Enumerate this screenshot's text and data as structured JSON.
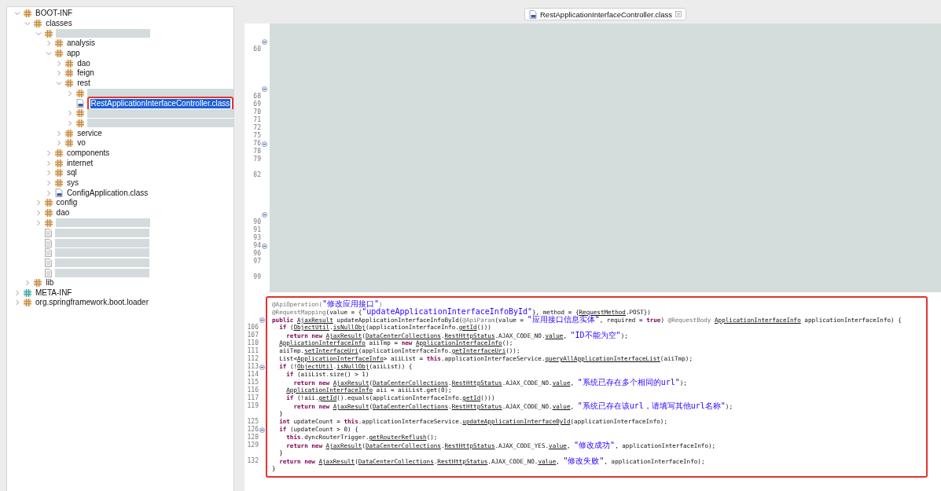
{
  "explorer": {
    "tree": [
      {
        "label": "BOOT-INF",
        "kind": "package",
        "expanded": true,
        "selected": false,
        "children": [
          {
            "label": "classes",
            "kind": "package",
            "expanded": true,
            "selected": false,
            "children": [
              {
                "redacted": true,
                "kind": "package",
                "expanded": true,
                "selected": false,
                "children": [
                  {
                    "label": "analysis",
                    "kind": "package",
                    "expanded": false,
                    "selected": false
                  },
                  {
                    "label": "app",
                    "kind": "package",
                    "expanded": true,
                    "selected": false,
                    "children": [
                      {
                        "label": "dao",
                        "kind": "package",
                        "expanded": false,
                        "selected": false
                      },
                      {
                        "label": "feign",
                        "kind": "package",
                        "expanded": false,
                        "selected": false
                      },
                      {
                        "label": "rest",
                        "kind": "package",
                        "expanded": true,
                        "selected": false,
                        "children": [
                          {
                            "redacted": true,
                            "kind": "package",
                            "expanded": false,
                            "selected": false
                          },
                          {
                            "label": "RestApplicationInterfaceController.class",
                            "kind": "class",
                            "selected": true,
                            "highlighted": true
                          },
                          {
                            "redacted": true,
                            "kind": "package",
                            "expanded": false,
                            "selected": false
                          },
                          {
                            "redacted": true,
                            "kind": "package",
                            "expanded": false,
                            "selected": false
                          }
                        ]
                      },
                      {
                        "label": "service",
                        "kind": "package",
                        "expanded": false,
                        "selected": false
                      },
                      {
                        "label": "vo",
                        "kind": "package",
                        "expanded": false,
                        "selected": false
                      }
                    ]
                  },
                  {
                    "label": "components",
                    "kind": "package",
                    "expanded": false,
                    "selected": false
                  },
                  {
                    "label": "internet",
                    "kind": "package",
                    "expanded": false,
                    "selected": false
                  },
                  {
                    "label": "sql",
                    "kind": "package",
                    "expanded": false,
                    "selected": false
                  },
                  {
                    "label": "sys",
                    "kind": "package",
                    "expanded": false,
                    "selected": false
                  },
                  {
                    "label": "ConfigApplication.class",
                    "kind": "class",
                    "expanded": false,
                    "selected": false
                  }
                ]
              },
              {
                "label": "config",
                "kind": "package",
                "expanded": false,
                "selected": false
              },
              {
                "label": "dao",
                "kind": "package",
                "expanded": false,
                "selected": false
              },
              {
                "redacted": true,
                "kind": "package",
                "expanded": false,
                "selected": false
              },
              {
                "redacted": true,
                "kind": "file",
                "selected": false
              },
              {
                "redacted": true,
                "kind": "file",
                "selected": false
              },
              {
                "redacted": true,
                "kind": "file",
                "selected": false
              },
              {
                "redacted": true,
                "kind": "file",
                "selected": false
              },
              {
                "redacted": true,
                "kind": "file",
                "selected": false
              }
            ]
          },
          {
            "label": "lib",
            "kind": "package",
            "expanded": false,
            "selected": false
          }
        ]
      },
      {
        "label": "META-INF",
        "kind": "folder",
        "expanded": false,
        "selected": false
      },
      {
        "label": "org.springframework.boot.loader",
        "kind": "package",
        "expanded": false,
        "selected": false
      }
    ]
  },
  "tab": {
    "label": "RestApplicationInterfaceController.class",
    "selected": true
  },
  "gutter": [
    {
      "fold": true
    },
    {
      "number": "60",
      "fold": false
    },
    {
      "fold": false
    },
    {
      "fold": false
    },
    {
      "fold": false
    },
    {
      "fold": false
    },
    {
      "fold": true
    },
    {
      "number": "68",
      "fold": false
    },
    {
      "number": "69",
      "fold": false
    },
    {
      "number": "70",
      "fold": false
    },
    {
      "number": "71",
      "fold": false
    },
    {
      "number": "72",
      "fold": false
    },
    {
      "number": "75",
      "fold": false
    },
    {
      "number": "76",
      "fold": true
    },
    {
      "number": "78",
      "fold": false
    },
    {
      "number": "79",
      "fold": false
    },
    {
      "fold": false
    },
    {
      "number": "82",
      "fold": false
    },
    {
      "fold": false
    },
    {
      "fold": false
    },
    {
      "fold": false
    },
    {
      "fold": false
    },
    {
      "fold": true
    },
    {
      "number": "90",
      "fold": false
    },
    {
      "number": "91",
      "fold": false
    },
    {
      "number": "93",
      "fold": false
    },
    {
      "number": "94",
      "fold": true
    },
    {
      "number": "96",
      "fold": false
    },
    {
      "number": "97",
      "fold": false
    },
    {
      "fold": false
    },
    {
      "number": "99",
      "fold": false
    }
  ],
  "code": {
    "highlighted": true,
    "lines": [
      {
        "fold": false,
        "tokens": [
          {
            "kind": "annotation",
            "text": "@ApiOperation("
          },
          {
            "kind": "string",
            "text": "\"修改应用接口\""
          },
          {
            "kind": "annotation",
            "text": ")"
          }
        ]
      },
      {
        "fold": false,
        "tokens": [
          {
            "kind": "annotation",
            "text": "@RequestMapping"
          },
          {
            "kind": "plain",
            "text": "(value = {"
          },
          {
            "kind": "string",
            "text": "\"updateApplicationInterfaceInfoById\""
          },
          {
            "kind": "plain",
            "text": "}, method = {"
          },
          {
            "kind": "link",
            "text": "RequestMethod"
          },
          {
            "kind": "plain",
            "text": ".POST})"
          }
        ]
      },
      {
        "fold": true,
        "tokens": [
          {
            "kind": "keyword",
            "text": "public"
          },
          {
            "kind": "link",
            "text": " AjaxResult"
          },
          {
            "kind": "plain",
            "text": " updateApplicationInterfaceInfoById("
          },
          {
            "kind": "annotation",
            "text": "@ApiParam"
          },
          {
            "kind": "plain",
            "text": "(value = "
          },
          {
            "kind": "string",
            "text": "\"应用接口信息实体\""
          },
          {
            "kind": "plain",
            "text": ", required = "
          },
          {
            "kind": "keyword",
            "text": "true"
          },
          {
            "kind": "plain",
            "text": ") "
          },
          {
            "kind": "annotation",
            "text": "@RequestBody"
          },
          {
            "kind": "link",
            "text": " ApplicationInterfaceInfo"
          },
          {
            "kind": "plain",
            "text": " applicationInterfaceInfo) {"
          }
        ]
      },
      {
        "number": "106",
        "fold": false,
        "tokens": [
          {
            "kind": "keyword",
            "text": "  if"
          },
          {
            "kind": "plain",
            "text": " ("
          },
          {
            "kind": "link",
            "text": "ObjectUtil"
          },
          {
            "kind": "plain",
            "text": "."
          },
          {
            "kind": "link",
            "text": "isNullObj"
          },
          {
            "kind": "plain",
            "text": "(applicationInterfaceInfo."
          },
          {
            "kind": "link",
            "text": "getId"
          },
          {
            "kind": "plain",
            "text": "()))"
          }
        ]
      },
      {
        "number": "107",
        "fold": false,
        "tokens": [
          {
            "kind": "keyword",
            "text": "    return new"
          },
          {
            "kind": "link",
            "text": " AjaxResult"
          },
          {
            "kind": "plain",
            "text": "("
          },
          {
            "kind": "link",
            "text": "DataCenterCollections"
          },
          {
            "kind": "plain",
            "text": "."
          },
          {
            "kind": "link",
            "text": "RestHttpStatus"
          },
          {
            "kind": "plain",
            "text": ".AJAX_CODE_NO."
          },
          {
            "kind": "link",
            "text": "value"
          },
          {
            "kind": "plain",
            "text": ", "
          },
          {
            "kind": "string",
            "text": "\"ID不能为空\""
          },
          {
            "kind": "plain",
            "text": ");"
          }
        ]
      },
      {
        "number": "110",
        "fold": false,
        "tokens": [
          {
            "kind": "link",
            "text": "  ApplicationInterfaceInfo"
          },
          {
            "kind": "plain",
            "text": " aiiTmp = "
          },
          {
            "kind": "keyword",
            "text": "new"
          },
          {
            "kind": "link",
            "text": " ApplicationInterfaceInfo"
          },
          {
            "kind": "plain",
            "text": "();"
          }
        ]
      },
      {
        "number": "111",
        "fold": false,
        "tokens": [
          {
            "kind": "plain",
            "text": "  aiiTmp."
          },
          {
            "kind": "link",
            "text": "setInterfaceUri"
          },
          {
            "kind": "plain",
            "text": "(applicationInterfaceInfo."
          },
          {
            "kind": "link",
            "text": "getInterfaceUri"
          },
          {
            "kind": "plain",
            "text": "());"
          }
        ]
      },
      {
        "number": "112",
        "fold": false,
        "tokens": [
          {
            "kind": "plain",
            "text": "  List<"
          },
          {
            "kind": "link",
            "text": "ApplicationInterfaceInfo"
          },
          {
            "kind": "plain",
            "text": "> aiiList = "
          },
          {
            "kind": "keyword",
            "text": "this"
          },
          {
            "kind": "plain",
            "text": ".applicationInterfaceService."
          },
          {
            "kind": "link",
            "text": "queryAllApplicationInterfaceList"
          },
          {
            "kind": "plain",
            "text": "(aiiTmp);"
          }
        ]
      },
      {
        "number": "113",
        "fold": true,
        "tokens": [
          {
            "kind": "keyword",
            "text": "  if"
          },
          {
            "kind": "plain",
            "text": " (!"
          },
          {
            "kind": "link",
            "text": "ObjectUtil"
          },
          {
            "kind": "plain",
            "text": "."
          },
          {
            "kind": "link",
            "text": "isNullObj"
          },
          {
            "kind": "plain",
            "text": "(aiiList)) {"
          }
        ]
      },
      {
        "number": "114",
        "fold": false,
        "tokens": [
          {
            "kind": "keyword",
            "text": "    if"
          },
          {
            "kind": "plain",
            "text": " (aiiList.size() > 1)"
          }
        ]
      },
      {
        "number": "115",
        "fold": false,
        "tokens": [
          {
            "kind": "keyword",
            "text": "      return new"
          },
          {
            "kind": "link",
            "text": " AjaxResult"
          },
          {
            "kind": "plain",
            "text": "("
          },
          {
            "kind": "link",
            "text": "DataCenterCollections"
          },
          {
            "kind": "plain",
            "text": "."
          },
          {
            "kind": "link",
            "text": "RestHttpStatus"
          },
          {
            "kind": "plain",
            "text": ".AJAX_CODE_NO."
          },
          {
            "kind": "link",
            "text": "value"
          },
          {
            "kind": "plain",
            "text": ", "
          },
          {
            "kind": "string",
            "text": "\"系统已存在多个相同的url\""
          },
          {
            "kind": "plain",
            "text": ");"
          }
        ]
      },
      {
        "number": "116",
        "fold": false,
        "tokens": [
          {
            "kind": "link",
            "text": "    ApplicationInterfaceInfo"
          },
          {
            "kind": "plain",
            "text": " aii = aiiList.get(0);"
          }
        ]
      },
      {
        "number": "117",
        "fold": false,
        "tokens": [
          {
            "kind": "keyword",
            "text": "    if"
          },
          {
            "kind": "plain",
            "text": " (!aii."
          },
          {
            "kind": "link",
            "text": "getId"
          },
          {
            "kind": "plain",
            "text": "().equals(applicationInterfaceInfo."
          },
          {
            "kind": "link",
            "text": "getId"
          },
          {
            "kind": "plain",
            "text": "()))"
          }
        ]
      },
      {
        "number": "119",
        "fold": false,
        "tokens": [
          {
            "kind": "keyword",
            "text": "      return new"
          },
          {
            "kind": "link",
            "text": " AjaxResult"
          },
          {
            "kind": "plain",
            "text": "("
          },
          {
            "kind": "link",
            "text": "DataCenterCollections"
          },
          {
            "kind": "plain",
            "text": "."
          },
          {
            "kind": "link",
            "text": "RestHttpStatus"
          },
          {
            "kind": "plain",
            "text": ".AJAX_CODE_NO."
          },
          {
            "kind": "link",
            "text": "value"
          },
          {
            "kind": "plain",
            "text": ", "
          },
          {
            "kind": "string",
            "text": "\"系统已存在该url，请填写其他url名称\""
          },
          {
            "kind": "plain",
            "text": ");"
          }
        ]
      },
      {
        "fold": false,
        "tokens": [
          {
            "kind": "plain",
            "text": "  }"
          }
        ]
      },
      {
        "number": "125",
        "fold": false,
        "tokens": [
          {
            "kind": "keyword",
            "text": "  int"
          },
          {
            "kind": "plain",
            "text": " updateCount = "
          },
          {
            "kind": "keyword",
            "text": "this"
          },
          {
            "kind": "plain",
            "text": ".applicationInterfaceService."
          },
          {
            "kind": "link",
            "text": "updateApplicationInterfaceById"
          },
          {
            "kind": "plain",
            "text": "(applicationInterfaceInfo);"
          }
        ]
      },
      {
        "number": "126",
        "fold": true,
        "tokens": [
          {
            "kind": "keyword",
            "text": "  if"
          },
          {
            "kind": "plain",
            "text": " (updateCount > 0) {"
          }
        ]
      },
      {
        "number": "128",
        "fold": false,
        "tokens": [
          {
            "kind": "keyword",
            "text": "    this"
          },
          {
            "kind": "plain",
            "text": ".dyncRouterTrigger."
          },
          {
            "kind": "link",
            "text": "getRouterReflush"
          },
          {
            "kind": "plain",
            "text": "();"
          }
        ]
      },
      {
        "number": "129",
        "fold": false,
        "tokens": [
          {
            "kind": "keyword",
            "text": "    return new"
          },
          {
            "kind": "link",
            "text": " AjaxResult"
          },
          {
            "kind": "plain",
            "text": "("
          },
          {
            "kind": "link",
            "text": "DataCenterCollections"
          },
          {
            "kind": "plain",
            "text": "."
          },
          {
            "kind": "link",
            "text": "RestHttpStatus"
          },
          {
            "kind": "plain",
            "text": ".AJAX_CODE_YES."
          },
          {
            "kind": "link",
            "text": "value"
          },
          {
            "kind": "plain",
            "text": ", "
          },
          {
            "kind": "string",
            "text": "\"修改成功\""
          },
          {
            "kind": "plain",
            "text": ", applicationInterfaceInfo);"
          }
        ]
      },
      {
        "fold": false,
        "tokens": [
          {
            "kind": "plain",
            "text": "  }"
          }
        ]
      },
      {
        "number": "132",
        "fold": false,
        "tokens": [
          {
            "kind": "keyword",
            "text": "  return new"
          },
          {
            "kind": "link",
            "text": " AjaxResult"
          },
          {
            "kind": "plain",
            "text": "("
          },
          {
            "kind": "link",
            "text": "DataCenterCollections"
          },
          {
            "kind": "plain",
            "text": "."
          },
          {
            "kind": "link",
            "text": "RestHttpStatus"
          },
          {
            "kind": "plain",
            "text": ".AJAX_CODE_NO."
          },
          {
            "kind": "link",
            "text": "value"
          },
          {
            "kind": "plain",
            "text": ", "
          },
          {
            "kind": "string",
            "text": "\"修改失败\""
          },
          {
            "kind": "plain",
            "text": ", applicationInterfaceInfo);"
          }
        ]
      },
      {
        "fold": false,
        "tokens": [
          {
            "kind": "plain",
            "text": "}"
          }
        ]
      }
    ]
  }
}
